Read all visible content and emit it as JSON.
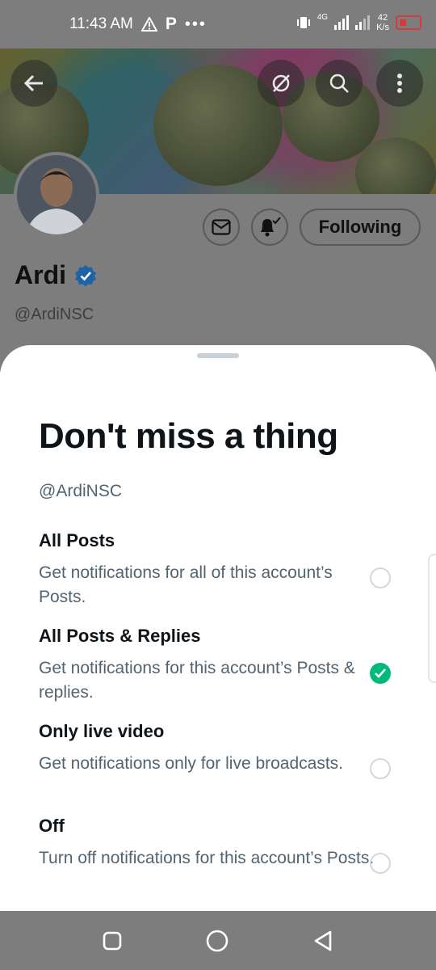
{
  "status_bar": {
    "time": "11:43 AM",
    "icons": [
      "warning-icon",
      "parking-icon",
      "more-dots-icon"
    ],
    "network": "4G",
    "speed_value": "42",
    "speed_unit": "K/s"
  },
  "profile": {
    "name": "Ardi",
    "handle": "@ArdiNSC",
    "following_label": "Following",
    "verified_color": "#1d9bf0"
  },
  "sheet": {
    "title": "Don't miss a thing",
    "handle": "@ArdiNSC",
    "options": [
      {
        "title": "All Posts",
        "desc": "Get notifications for all of this account’s Posts.",
        "selected": false
      },
      {
        "title": "All Posts & Replies",
        "desc": "Get notifications for this account’s Posts & replies.",
        "selected": true
      },
      {
        "title": "Only live video",
        "desc": "Get notifications only for live broadcasts.",
        "selected": false
      },
      {
        "title": "Off",
        "desc": "Turn off notifications for this account’s Posts.",
        "selected": false
      }
    ],
    "accent_color": "#00ba7c"
  },
  "nav_bar": {
    "buttons": [
      "recents-square-icon",
      "home-circle-icon",
      "back-triangle-icon"
    ]
  }
}
